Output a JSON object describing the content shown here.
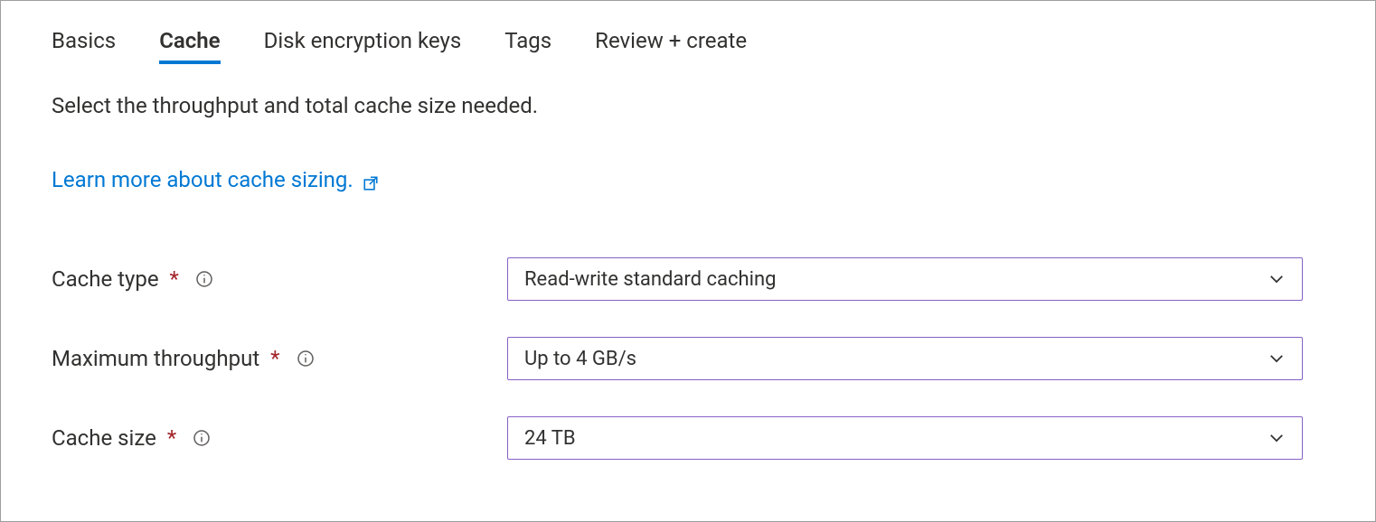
{
  "tabs": {
    "basics": "Basics",
    "cache": "Cache",
    "disk_encryption": "Disk encryption keys",
    "tags": "Tags",
    "review": "Review + create"
  },
  "description": "Select the throughput and total cache size needed.",
  "learn_more": "Learn more about cache sizing.",
  "form": {
    "cache_type": {
      "label": "Cache type",
      "value": "Read-write standard caching"
    },
    "max_throughput": {
      "label": "Maximum throughput",
      "value": "Up to 4 GB/s"
    },
    "cache_size": {
      "label": "Cache size",
      "value": "24 TB"
    }
  },
  "colors": {
    "accent": "#0078d4",
    "select_border": "#8661c5",
    "required": "#a4262c"
  }
}
